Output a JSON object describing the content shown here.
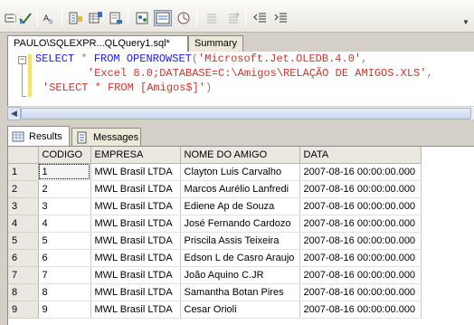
{
  "toolbar": {
    "buttons": [
      {
        "name": "specify-values-icon"
      },
      {
        "name": "check-syntax-icon"
      },
      {
        "name": "parse-icon"
      },
      {
        "name": "results-to-text-icon"
      },
      {
        "name": "results-to-grid-icon"
      },
      {
        "name": "results-to-file-icon"
      },
      {
        "name": "display-plan-icon"
      },
      {
        "name": "include-plan-icon"
      },
      {
        "name": "client-stats-icon"
      },
      {
        "name": "comment-icon"
      },
      {
        "name": "uncomment-icon"
      },
      {
        "name": "decrease-indent-icon"
      },
      {
        "name": "increase-indent-icon"
      }
    ],
    "overflow_icon": "chevron-down-icon"
  },
  "tabs": {
    "active_label": "PAULO\\SQLEXPR...QLQuery1.sql*",
    "summary_label": "Summary"
  },
  "editor": {
    "line1": {
      "kw1": "SELECT",
      "op": " * ",
      "kw2": "FROM",
      "kw3": " OPENROWSET",
      "p1": "(",
      "s1": "'Microsoft.Jet.OLEDB.4.0'",
      "c1": ","
    },
    "line2": {
      "s2": "'Excel 8.0;DATABASE=C:\\Amigos\\RELAÇÃO DE AMIGOS.XLS'",
      "c2": ","
    },
    "line3": {
      "s3": "'SELECT * FROM [Amigos$]'",
      "p2": ")"
    }
  },
  "result_tabs": {
    "results_label": "Results",
    "messages_label": "Messages"
  },
  "grid": {
    "columns": [
      "CODIGO",
      "EMPRESA",
      "NOME DO AMIGO",
      "DATA"
    ],
    "rows": [
      {
        "n": "1",
        "codigo": "1",
        "empresa": "MWL Brasil LTDA",
        "nome": "Clayton Luis Carvalho",
        "data": "2007-08-16 00:00:00.000"
      },
      {
        "n": "2",
        "codigo": "2",
        "empresa": "MWL Brasil LTDA",
        "nome": "Marcos Aurélio Lanfredi",
        "data": "2007-08-16 00:00:00.000"
      },
      {
        "n": "3",
        "codigo": "3",
        "empresa": "MWL Brasil LTDA",
        "nome": "Ediene Ap de Souza",
        "data": "2007-08-16 00:00:00.000"
      },
      {
        "n": "4",
        "codigo": "4",
        "empresa": "MWL Brasil LTDA",
        "nome": "José Fernando Cardozo",
        "data": "2007-08-16 00:00:00.000"
      },
      {
        "n": "5",
        "codigo": "5",
        "empresa": "MWL Brasil LTDA",
        "nome": "Priscila Assis Teixeira",
        "data": "2007-08-16 00:00:00.000"
      },
      {
        "n": "6",
        "codigo": "6",
        "empresa": "MWL Brasil LTDA",
        "nome": "Edson L de Casro Araujo",
        "data": "2007-08-16 00:00:00.000"
      },
      {
        "n": "7",
        "codigo": "7",
        "empresa": "MWL Brasil LTDA",
        "nome": "João Aquino C.JR",
        "data": "2007-08-16 00:00:00.000"
      },
      {
        "n": "8",
        "codigo": "8",
        "empresa": "MWL Brasil LTDA",
        "nome": "Samantha Botan Pires",
        "data": "2007-08-16 00:00:00.000"
      },
      {
        "n": "9",
        "codigo": "9",
        "empresa": "MWL Brasil LTDA",
        "nome": "Cesar Orioli",
        "data": "2007-08-16 00:00:00.000"
      }
    ]
  },
  "colors": {
    "keyword": "#1a1aff",
    "string": "#d5322a",
    "operator": "#808080"
  }
}
